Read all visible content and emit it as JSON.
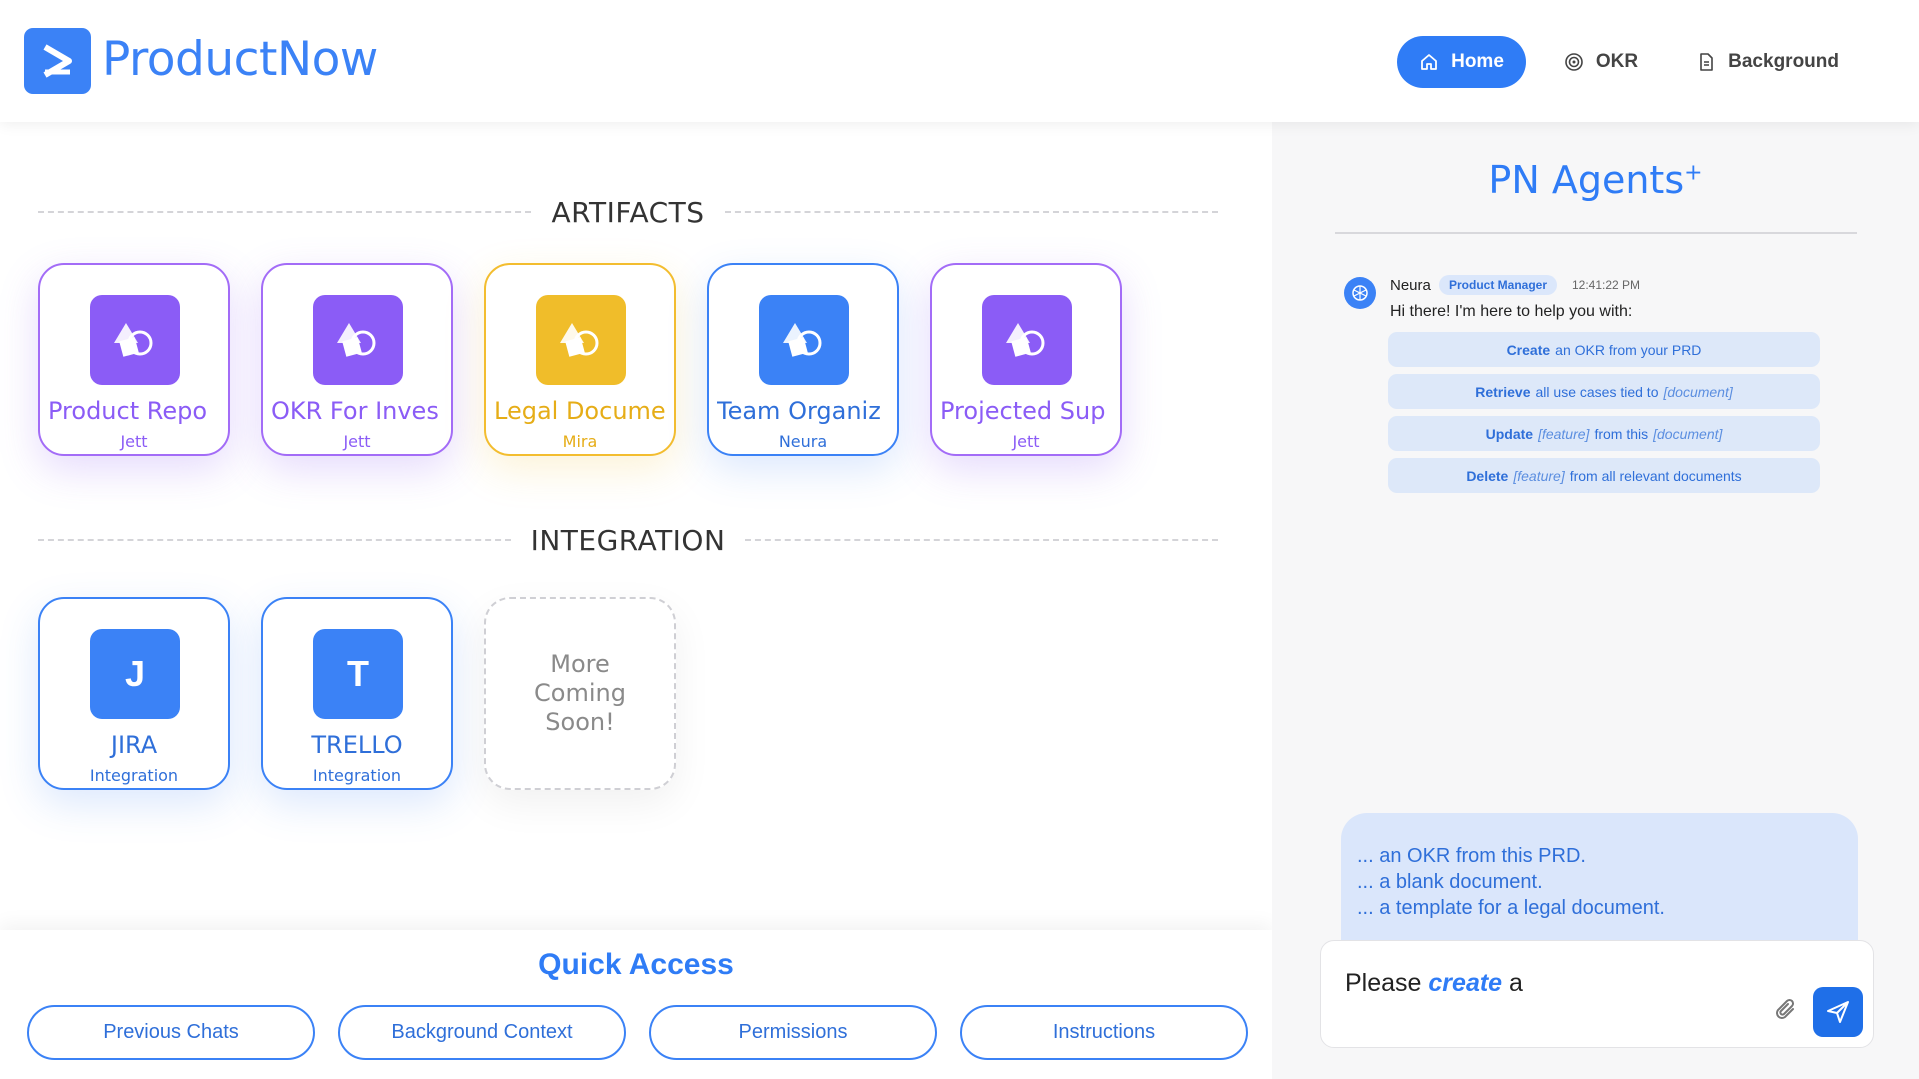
{
  "app": {
    "name": "ProductNow"
  },
  "nav": {
    "items": [
      {
        "label": "Home",
        "icon": "home-icon",
        "active": true
      },
      {
        "label": "OKR",
        "icon": "target-icon",
        "active": false
      },
      {
        "label": "Background",
        "icon": "document-icon",
        "active": false
      }
    ]
  },
  "sections": {
    "artifacts_title": "ARTIFACTS",
    "integration_title": "INTEGRATION"
  },
  "artifacts": [
    {
      "name": "Product Repo",
      "agent": "Jett",
      "color": "purple"
    },
    {
      "name": "OKR For Inves",
      "agent": "Jett",
      "color": "purple"
    },
    {
      "name": "Legal Docume",
      "agent": "Mira",
      "color": "yellow"
    },
    {
      "name": "Team Organiz",
      "agent": "Neura",
      "color": "blue"
    },
    {
      "name": "Projected Sup",
      "agent": "Jett",
      "color": "purple"
    }
  ],
  "integrations": [
    {
      "letter": "J",
      "name": "JIRA",
      "sub": "Integration"
    },
    {
      "letter": "T",
      "name": "TRELLO",
      "sub": "Integration"
    }
  ],
  "more": {
    "line1": "More",
    "line2": "Coming",
    "line3": "Soon!"
  },
  "quick_access": {
    "title": "Quick Access",
    "buttons": [
      "Previous Chats",
      "Background Context",
      "Permissions",
      "Instructions"
    ]
  },
  "panel": {
    "title": "PN Agents",
    "title_sup": "+",
    "message": {
      "sender": "Neura",
      "role": "Product Manager",
      "time": "12:41:22 PM",
      "text": "Hi there! I'm here to help you with:"
    },
    "suggestions": [
      {
        "verb": "Create",
        "rest": "an OKR from your PRD",
        "vars": []
      },
      {
        "verb": "Retrieve",
        "rest": "all use cases tied to",
        "var": "[document]"
      },
      {
        "verb": "Update",
        "var1": "[feature]",
        "mid": "from this",
        "var2": "[document]"
      },
      {
        "verb": "Delete",
        "var1": "[feature]",
        "mid": "from all relevant documents"
      }
    ],
    "autocomplete": [
      "... an OKR from this PRD.",
      "... a blank document.",
      "... a template for a legal document."
    ],
    "input": {
      "prefix": "Please",
      "keyword": "create",
      "suffix": "a"
    }
  },
  "colors": {
    "accent": "#3b82f6",
    "purple": "#8b5cf6",
    "yellow": "#f0bd2a"
  }
}
